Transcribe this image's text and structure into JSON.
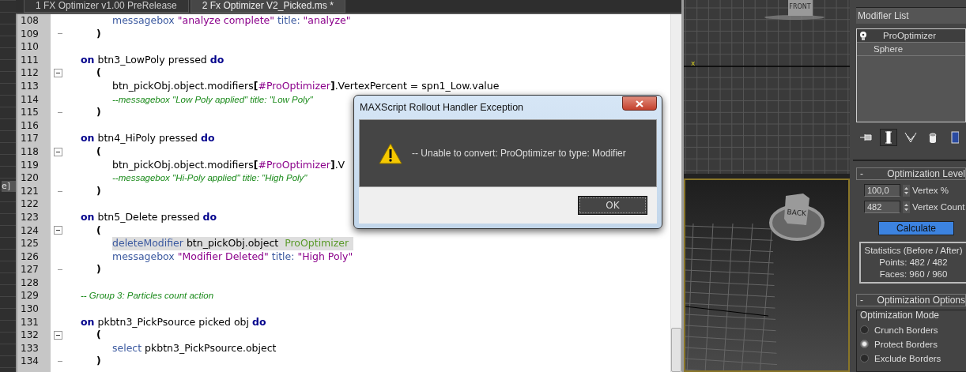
{
  "left_strip": {
    "label": "e]"
  },
  "editor": {
    "tabs": [
      {
        "label": "1 FX Optimizer v1.00 PreRelease",
        "selected": false
      },
      {
        "label": "2 Fx Optimizer V2_Picked.ms *",
        "selected": true
      }
    ],
    "lines": [
      {
        "number": "108",
        "kind": "inner",
        "highlighted": false,
        "tokens": [
          {
            "kind": "fn",
            "text": "messagebox"
          },
          {
            "kind": "str",
            "text": " \"analyze complete\""
          },
          {
            "kind": "fn",
            "text": " title:"
          },
          {
            "kind": "str",
            "text": " \"analyze\""
          }
        ]
      },
      {
        "number": "109",
        "kind": "close",
        "highlighted": false,
        "tokens": [
          {
            "kind": "bracket",
            "text": ")"
          }
        ]
      },
      {
        "number": "110",
        "kind": "blank"
      },
      {
        "number": "111",
        "kind": "outer",
        "highlighted": false,
        "tokens": [
          {
            "kind": "kw",
            "text": "on"
          },
          {
            "kind": "plain",
            "text": " btn3_LowPoly pressed "
          },
          {
            "kind": "kw",
            "text": "do"
          }
        ]
      },
      {
        "number": "112",
        "kind": "open",
        "highlighted": false,
        "tokens": [
          {
            "kind": "bracket",
            "text": "("
          }
        ]
      },
      {
        "number": "113",
        "kind": "inner",
        "highlighted": false,
        "tokens": [
          {
            "kind": "plain",
            "text": "btn_pickObj.object.modifiers"
          },
          {
            "kind": "bracket",
            "text": "["
          },
          {
            "kind": "sym",
            "text": "#ProOptimizer"
          },
          {
            "kind": "bracket",
            "text": "]"
          },
          {
            "kind": "plain",
            "text": ".VertexPercent = spn1_Low.value"
          }
        ]
      },
      {
        "number": "114",
        "kind": "inner",
        "highlighted": false,
        "tokens": [
          {
            "kind": "comment",
            "text": "--messagebox \"Low Poly applied\" title: \"Low Poly\""
          }
        ]
      },
      {
        "number": "115",
        "kind": "close",
        "highlighted": false,
        "tokens": [
          {
            "kind": "bracket",
            "text": ")"
          }
        ]
      },
      {
        "number": "116",
        "kind": "blank"
      },
      {
        "number": "117",
        "kind": "outer",
        "highlighted": false,
        "tokens": [
          {
            "kind": "kw",
            "text": "on"
          },
          {
            "kind": "plain",
            "text": " btn4_HiPoly pressed "
          },
          {
            "kind": "kw",
            "text": "do"
          }
        ]
      },
      {
        "number": "118",
        "kind": "open",
        "highlighted": false,
        "tokens": [
          {
            "kind": "bracket",
            "text": "("
          }
        ]
      },
      {
        "number": "119",
        "kind": "inner",
        "highlighted": false,
        "tokens": [
          {
            "kind": "plain",
            "text": "btn_pickObj.object.modifiers"
          },
          {
            "kind": "bracket",
            "text": "["
          },
          {
            "kind": "sym",
            "text": "#ProOptimizer"
          },
          {
            "kind": "bracket",
            "text": "]"
          },
          {
            "kind": "plain",
            "text": ".V"
          }
        ]
      },
      {
        "number": "120",
        "kind": "inner",
        "highlighted": false,
        "tokens": [
          {
            "kind": "comment",
            "text": "--messagebox \"Hi-Poly applied\" title: \"High Poly\""
          }
        ]
      },
      {
        "number": "121",
        "kind": "close",
        "highlighted": false,
        "tokens": [
          {
            "kind": "bracket",
            "text": ")"
          }
        ]
      },
      {
        "number": "122",
        "kind": "blank"
      },
      {
        "number": "123",
        "kind": "outer",
        "highlighted": false,
        "tokens": [
          {
            "kind": "kw",
            "text": "on"
          },
          {
            "kind": "plain",
            "text": " btn5_Delete pressed "
          },
          {
            "kind": "kw",
            "text": "do"
          }
        ]
      },
      {
        "number": "124",
        "kind": "open",
        "highlighted": false,
        "tokens": [
          {
            "kind": "bracket",
            "text": "("
          }
        ]
      },
      {
        "number": "125",
        "kind": "inner",
        "highlighted": true,
        "tokens": [
          {
            "kind": "fn",
            "text": "deleteModifier"
          },
          {
            "kind": "plain",
            "text": " btn_pickObj.object "
          },
          {
            "kind": "ident",
            "text": " ProOptimizer"
          }
        ]
      },
      {
        "number": "126",
        "kind": "inner",
        "highlighted": false,
        "tokens": [
          {
            "kind": "fn",
            "text": "messagebox"
          },
          {
            "kind": "str",
            "text": " \"Modifier Deleted\""
          },
          {
            "kind": "fn",
            "text": " title:"
          },
          {
            "kind": "str",
            "text": " \"High Poly\""
          }
        ]
      },
      {
        "number": "127",
        "kind": "close",
        "highlighted": false,
        "tokens": [
          {
            "kind": "bracket",
            "text": ")"
          }
        ]
      },
      {
        "number": "128",
        "kind": "blank"
      },
      {
        "number": "129",
        "kind": "outer",
        "highlighted": false,
        "tokens": [
          {
            "kind": "comment",
            "text": "-- Group 3: Particles count action"
          }
        ]
      },
      {
        "number": "130",
        "kind": "blank"
      },
      {
        "number": "131",
        "kind": "outer",
        "highlighted": false,
        "tokens": [
          {
            "kind": "kw",
            "text": "on"
          },
          {
            "kind": "plain",
            "text": " pkbtn3_PickPsource picked obj "
          },
          {
            "kind": "kw",
            "text": "do"
          }
        ]
      },
      {
        "number": "132",
        "kind": "open",
        "highlighted": false,
        "tokens": [
          {
            "kind": "bracket",
            "text": "("
          }
        ]
      },
      {
        "number": "133",
        "kind": "inner",
        "highlighted": false,
        "tokens": [
          {
            "kind": "fn",
            "text": "select"
          },
          {
            "kind": "plain",
            "text": " pkbtn3_PickPsource.object"
          }
        ]
      },
      {
        "number": "134",
        "kind": "close",
        "highlighted": false,
        "tokens": [
          {
            "kind": "bracket",
            "text": ")"
          }
        ]
      }
    ]
  },
  "viewports": {
    "top": {
      "viewcube_label": "FRONT",
      "axis_label": "x"
    },
    "bottom": {
      "viewcube_label": "BACK"
    }
  },
  "command_panel": {
    "modifier_list": "Modifier List",
    "stack": [
      {
        "label": "ProOptimizer",
        "kind": "modifier",
        "selected": true
      },
      {
        "label": "Sphere",
        "kind": "object",
        "selected": false
      }
    ],
    "toolbar": [
      {
        "kind": "pin",
        "on": false
      },
      {
        "kind": "ibeam",
        "on": true
      },
      {
        "kind": "fork",
        "on": false
      },
      {
        "kind": "cylinder",
        "on": false
      },
      {
        "kind": "panel",
        "on": false
      }
    ],
    "optimization_level": {
      "collapse": "-",
      "title": "Optimization Level",
      "spinners": [
        {
          "value": "100,0",
          "label": "Vertex %"
        },
        {
          "value": "482",
          "label": "Vertex Count"
        }
      ],
      "button": "Calculate",
      "statistics": [
        "Statistics (Before / After)",
        "Points: 482 / 482",
        "Faces: 960 / 960"
      ]
    },
    "optimization_options": {
      "collapse": "-",
      "title": "Optimization Options",
      "group": "Optimization Mode",
      "modes": [
        {
          "label": "Crunch Borders",
          "selected": false
        },
        {
          "label": "Protect Borders",
          "selected": true
        },
        {
          "label": "Exclude Borders",
          "selected": false
        }
      ]
    }
  },
  "dialog": {
    "title": "MAXScript Rollout Handler Exception",
    "message": "-- Unable to convert: ProOptimizer to type: Modifier",
    "button": "OK"
  }
}
